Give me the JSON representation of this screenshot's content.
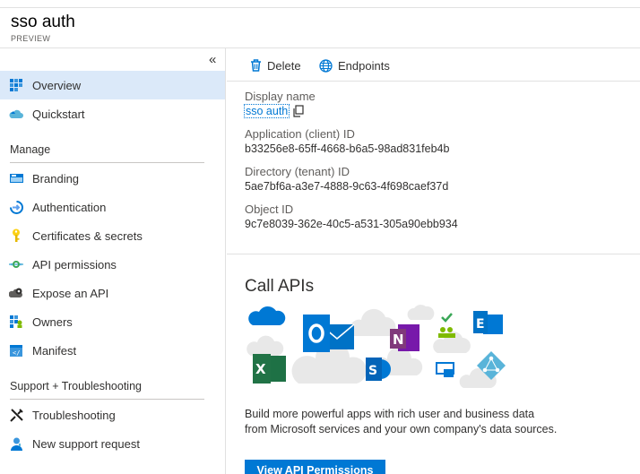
{
  "header": {
    "title": "sso auth",
    "subtitle": "PREVIEW"
  },
  "sidebar": {
    "collapse_label": "«",
    "top_items": [
      {
        "label": "Overview",
        "icon": "grid-icon",
        "selected": true
      },
      {
        "label": "Quickstart",
        "icon": "cloud-icon",
        "selected": false
      }
    ],
    "sections": [
      {
        "title": "Manage",
        "items": [
          {
            "label": "Branding",
            "icon": "branding-icon"
          },
          {
            "label": "Authentication",
            "icon": "authentication-icon"
          },
          {
            "label": "Certificates & secrets",
            "icon": "key-icon"
          },
          {
            "label": "API permissions",
            "icon": "api-permissions-icon"
          },
          {
            "label": "Expose an API",
            "icon": "cloud-gear-icon"
          },
          {
            "label": "Owners",
            "icon": "owners-icon"
          },
          {
            "label": "Manifest",
            "icon": "manifest-icon"
          }
        ]
      },
      {
        "title": "Support + Troubleshooting",
        "items": [
          {
            "label": "Troubleshooting",
            "icon": "wrench-icon"
          },
          {
            "label": "New support request",
            "icon": "support-person-icon"
          }
        ]
      }
    ]
  },
  "toolbar": {
    "delete_label": "Delete",
    "endpoints_label": "Endpoints"
  },
  "properties": {
    "display_name_label": "Display name",
    "display_name_value": "sso auth",
    "app_id_label": "Application (client) ID",
    "app_id_value": "b33256e8-65ff-4668-b6a5-98ad831feb4b",
    "tenant_id_label": "Directory (tenant) ID",
    "tenant_id_value": "5ae7bf6a-a3e7-4888-9c63-4f698caef37d",
    "object_id_label": "Object ID",
    "object_id_value": "9c7e8039-362e-40c5-a531-305a90ebb934"
  },
  "call_apis": {
    "title": "Call APIs",
    "description": "Build more powerful apps with rich user and business data from Microsoft services and your own company's data sources.",
    "button_label": "View API Permissions"
  },
  "colors": {
    "accent": "#0078d4",
    "selected_bg": "#dbe9f9"
  }
}
